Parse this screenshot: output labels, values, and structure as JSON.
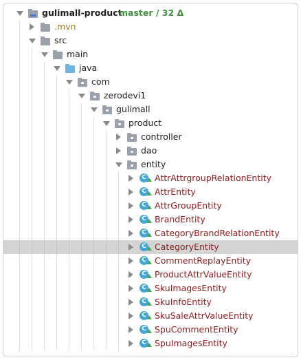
{
  "project": {
    "name": "gulimall-product",
    "vcs_status": "master / 32 Δ"
  },
  "tree": [
    {
      "label": "gulimall-product",
      "depth": 0,
      "arrow": "expanded",
      "icon": "module-folder-icon",
      "style": "project"
    },
    {
      "label": ".mvn",
      "depth": 1,
      "arrow": "collapsed",
      "icon": "folder-icon",
      "style": "mvn"
    },
    {
      "label": "src",
      "depth": 1,
      "arrow": "expanded",
      "icon": "folder-icon",
      "style": "normal"
    },
    {
      "label": "main",
      "depth": 2,
      "arrow": "expanded",
      "icon": "folder-icon",
      "style": "normal"
    },
    {
      "label": "java",
      "depth": 3,
      "arrow": "expanded",
      "icon": "source-folder-icon",
      "style": "normal"
    },
    {
      "label": "com",
      "depth": 4,
      "arrow": "expanded",
      "icon": "package-icon",
      "style": "normal"
    },
    {
      "label": "zerodevi1",
      "depth": 5,
      "arrow": "expanded",
      "icon": "package-icon",
      "style": "normal"
    },
    {
      "label": "gulimall",
      "depth": 6,
      "arrow": "expanded",
      "icon": "package-icon",
      "style": "normal"
    },
    {
      "label": "product",
      "depth": 7,
      "arrow": "expanded",
      "icon": "package-icon",
      "style": "normal"
    },
    {
      "label": "controller",
      "depth": 8,
      "arrow": "collapsed",
      "icon": "package-icon",
      "style": "normal"
    },
    {
      "label": "dao",
      "depth": 8,
      "arrow": "collapsed",
      "icon": "package-icon",
      "style": "normal"
    },
    {
      "label": "entity",
      "depth": 8,
      "arrow": "expanded",
      "icon": "package-icon",
      "style": "normal"
    },
    {
      "label": "AttrAttrgroupRelationEntity",
      "depth": 9,
      "arrow": "collapsed",
      "icon": "class-icon",
      "style": "entity"
    },
    {
      "label": "AttrEntity",
      "depth": 9,
      "arrow": "collapsed",
      "icon": "class-icon",
      "style": "entity"
    },
    {
      "label": "AttrGroupEntity",
      "depth": 9,
      "arrow": "collapsed",
      "icon": "class-icon",
      "style": "entity"
    },
    {
      "label": "BrandEntity",
      "depth": 9,
      "arrow": "collapsed",
      "icon": "class-icon",
      "style": "entity"
    },
    {
      "label": "CategoryBrandRelationEntity",
      "depth": 9,
      "arrow": "collapsed",
      "icon": "class-icon",
      "style": "entity"
    },
    {
      "label": "CategoryEntity",
      "depth": 9,
      "arrow": "collapsed",
      "icon": "class-icon",
      "style": "entity",
      "selected": true
    },
    {
      "label": "CommentReplayEntity",
      "depth": 9,
      "arrow": "collapsed",
      "icon": "class-icon",
      "style": "entity"
    },
    {
      "label": "ProductAttrValueEntity",
      "depth": 9,
      "arrow": "collapsed",
      "icon": "class-icon",
      "style": "entity"
    },
    {
      "label": "SkuImagesEntity",
      "depth": 9,
      "arrow": "collapsed",
      "icon": "class-icon",
      "style": "entity"
    },
    {
      "label": "SkuInfoEntity",
      "depth": 9,
      "arrow": "collapsed",
      "icon": "class-icon",
      "style": "entity"
    },
    {
      "label": "SkuSaleAttrValueEntity",
      "depth": 9,
      "arrow": "collapsed",
      "icon": "class-icon",
      "style": "entity"
    },
    {
      "label": "SpuCommentEntity",
      "depth": 9,
      "arrow": "collapsed",
      "icon": "class-icon",
      "style": "entity"
    },
    {
      "label": "SpuImagesEntity",
      "depth": 9,
      "arrow": "collapsed",
      "icon": "class-icon",
      "style": "entity"
    }
  ],
  "class_icon_letter": "C",
  "colors": {
    "entity_text": "#8b2020",
    "branch_text": "#3f8f3f",
    "selection": "#d4d4d4",
    "class_icon": "#42a6d6"
  }
}
